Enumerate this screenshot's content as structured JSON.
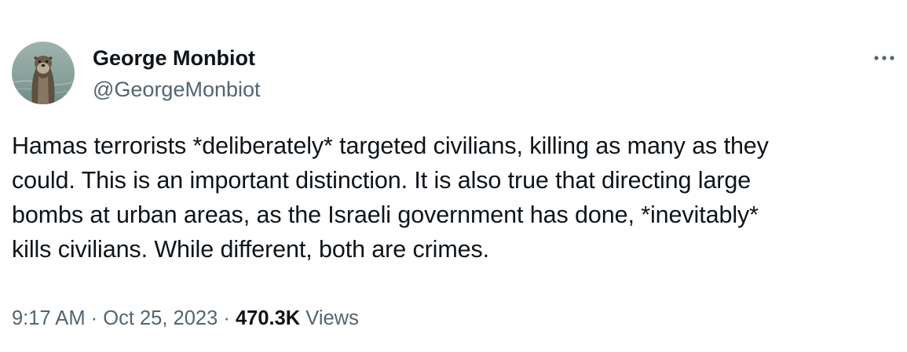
{
  "tweet": {
    "author": {
      "display_name": "George Monbiot",
      "handle": "@GeorgeMonbiot",
      "avatar": "otter-profile-photo"
    },
    "more_icon": "more-horizontal-icon",
    "text_lines": [
      "Hamas terrorists *deliberately* targeted civilians, killing as many as they",
      "could. This is an important distinction. It is also true that directing large",
      "bombs at urban areas, as the Israeli government has done, *inevitably*",
      "kills civilians. While different, both are crimes."
    ],
    "meta": {
      "time": "9:17 AM",
      "separator": "·",
      "date": "Oct 25, 2023",
      "views_count": "470.3K",
      "views_label": "Views"
    }
  },
  "colors": {
    "text_primary": "#0f1419",
    "text_secondary": "#536471",
    "background": "#ffffff"
  }
}
